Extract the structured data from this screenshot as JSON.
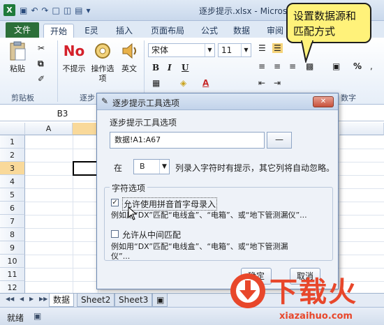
{
  "window": {
    "title": "逐步提示.xlsx - Microsoft Exc"
  },
  "tabs": [
    "文件",
    "开始",
    "E灵",
    "插入",
    "页面布局",
    "公式",
    "数据",
    "审阅"
  ],
  "ribbon": {
    "paste_label": "粘贴",
    "clipboard_group": "剪贴板",
    "no_hint_label": "不提示",
    "no_hint_icon_text": "No",
    "options_label": "操作选项",
    "english_label": "英文",
    "hint_group": "逐步",
    "font_name": "宋体",
    "font_size": "11",
    "number_group": "数字",
    "percent": "%"
  },
  "callout": {
    "text": "设置数据源和匹配方式"
  },
  "formula_bar": {
    "name_box": "B3"
  },
  "grid": {
    "columns": [
      "A"
    ],
    "rows": [
      "1",
      "2",
      "3",
      "4",
      "5",
      "6",
      "7",
      "8",
      "9",
      "10",
      "11",
      "12"
    ],
    "selected_row": "3"
  },
  "sheets": [
    "数据",
    "Sheet2",
    "Sheet3"
  ],
  "status": {
    "text": "就绪"
  },
  "dialog": {
    "title": "逐步提示工具选项",
    "section_label": "逐步提示工具选项",
    "range_value": "数据!A1:A67",
    "range_button": "—",
    "column_prefix": "在",
    "column_value": "B",
    "column_suffix": "列录入字符时有提示，其它列将自动忽略。",
    "char_options_legend": "字符选项",
    "option1": {
      "label": "允许使用拼音首字母录入",
      "checked": true,
      "example": "例如用“DX”匹配“电线盒”、“电箱”、或“地下管测漏仪”..."
    },
    "option2": {
      "label": "允许从中间匹配",
      "checked": false,
      "example_line1": "例如用“DX”匹配“电线盒”、“电箱”、或“地下管测漏",
      "example_line2": "仪”..."
    },
    "ok_button": "确定",
    "cancel_button": "取消"
  },
  "watermark": {
    "text": "下载火",
    "url": "xiazaihuo.com"
  }
}
